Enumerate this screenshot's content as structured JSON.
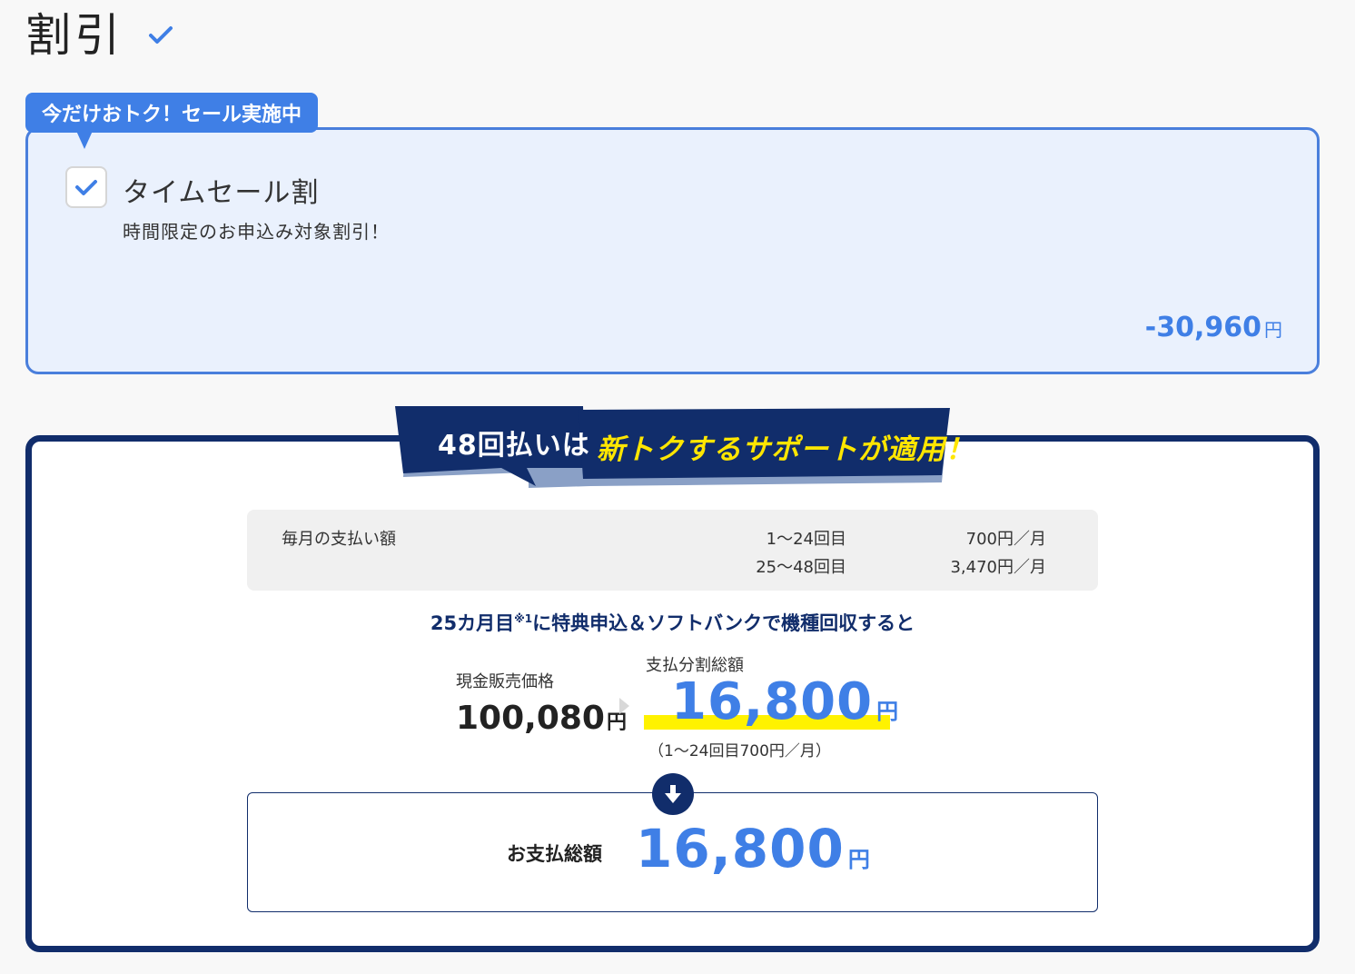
{
  "section": {
    "title": "割引"
  },
  "sale_badge": {
    "label": "今だけおトク！セール実施中"
  },
  "discount": {
    "checked": true,
    "title": "タイムセール割",
    "description": "時間限定のお申込み対象割引！",
    "amount": "-30,960",
    "unit": "円"
  },
  "banner": {
    "lead": "48回払いは",
    "main": "新トクするサポートが適用！"
  },
  "monthly": {
    "label": "毎月の支払い額",
    "rows": [
      {
        "range": "1～24回目",
        "value": "700円／月"
      },
      {
        "range": "25～48回目",
        "value": "3,470円／月"
      }
    ]
  },
  "condition": {
    "text_before": "25カ月目",
    "footnote": "※1",
    "text_after": "に特典申込＆ソフトバンクで機種回収すると"
  },
  "cash": {
    "label": "現金販売価格",
    "amount": "100,080",
    "unit": "円"
  },
  "installment": {
    "label": "支払分割総額",
    "amount": "16,800",
    "unit": "円",
    "note": "（1～24回目700円／月）"
  },
  "total": {
    "label": "お支払総額",
    "amount": "16,800",
    "unit": "円"
  },
  "colors": {
    "accent_blue": "#3f7fe6",
    "navy": "#112d6b",
    "highlight_yellow": "#fff200",
    "card_bg": "#eaf1fd"
  }
}
